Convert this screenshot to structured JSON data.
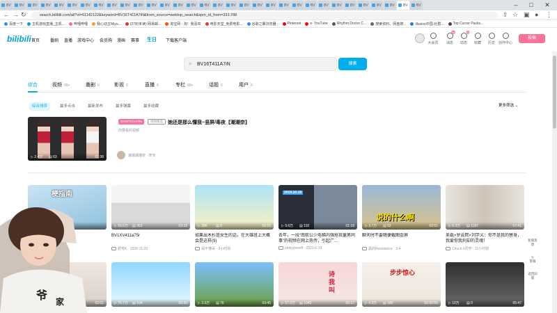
{
  "browser": {
    "tabs": [
      "BV",
      "BV",
      "BV",
      "BV",
      "BV",
      "BV",
      "BV",
      "BV",
      "BV",
      "BV",
      "BV",
      "BV",
      "BV",
      "BV",
      "BV",
      "BV",
      "BV",
      "BV",
      "BV",
      "BV",
      "BV",
      "BV",
      "BV",
      "BV",
      "BV",
      "BV",
      "BV",
      "BV",
      "BV",
      "BV",
      "BV",
      "BV"
    ],
    "active_tab": "BV",
    "url": "search.bilibili.com/all?vt=61142122&keyword=BV16T411A7iN&from_source=webtop_search&spm_id_from=333.788",
    "bookmarks": [
      "百度一下",
      "主机游戏直播_主机...",
      "哔哩哔哩",
      "我心动主Miyu...",
      "(27封未读) 网易邮...",
      "淘宝网 - 淘！我喜欢",
      "电影天堂_免费电影...",
      "谷歌之翼浏览器 -",
      "Pinterest",
      "e- YouTube",
      "Rhythm Doctor C...",
      "搜索资料、网盘搜...",
      "illusion中国-社群...",
      "Top Cursor Packs..."
    ],
    "bookmark_colors": [
      "#3388ff",
      "#00a1d6",
      "#fb7299",
      "#ff9a3c",
      "#d43c33",
      "#ff5000",
      "#d43c33",
      "#4285f4",
      "#e60023",
      "#ff0000",
      "#555555",
      "#666666",
      "#2b7cd3",
      "#444444"
    ]
  },
  "header": {
    "logo": "bilibili",
    "nav": [
      "首页",
      "番剧",
      "直播",
      "游戏中心",
      "会员购",
      "漫画",
      "赛事",
      "生日",
      "下载客户端"
    ],
    "user_menu": [
      "大会员",
      "消息",
      "动态",
      "收藏",
      "历史",
      "创作中心"
    ],
    "message_badge": "99",
    "dynamic_badge": "3",
    "upload": "投稿"
  },
  "search": {
    "query": "BV16T411A7iN",
    "button": "搜索"
  },
  "type_tabs": [
    {
      "label": "综合",
      "count": ""
    },
    {
      "label": "视频",
      "count": "99+"
    },
    {
      "label": "番剧",
      "count": "0"
    },
    {
      "label": "影视",
      "count": "0"
    },
    {
      "label": "直播",
      "count": "0"
    },
    {
      "label": "专栏",
      "count": "99+"
    },
    {
      "label": "话题",
      "count": "0"
    },
    {
      "label": "用户",
      "count": "0"
    }
  ],
  "sort": [
    "综合排序",
    "最多点击",
    "最新发布",
    "最多弹幕",
    "最多收藏"
  ],
  "more_filter": "更多筛选",
  "top_result": {
    "tag": "BV16T411A7iN",
    "tag2": "视频精选",
    "title": "她还是那么懂我~竖屏/毒夜【潮潮奈】",
    "subtitle": "你要看的视频",
    "plays": "2.4万",
    "danmaku": "63",
    "duration": "01:38",
    "uploader": "潮潮潮潮奈 · 昨天"
  },
  "videos": [
    {
      "title": "",
      "plays": "",
      "danmaku": "",
      "duration": "",
      "uploader": "",
      "date": "",
      "thumb_text": "梗指南"
    },
    {
      "title": "BV1XV411a75r",
      "plays": "93.6万",
      "danmaku": "363",
      "duration": "03:18",
      "uploader": "肥宅K",
      "date": "2020-11-29",
      "thumb_text": ""
    },
    {
      "title": "如果出木杉是女生的话，在大雄班上大概会是这样(9)",
      "plays": "386",
      "danmaku": "0",
      "duration": "02:55",
      "uploader": "闹不懂哥",
      "date": "3小时前",
      "thumb_text": ""
    },
    {
      "title": "去年，一段“南航公少电梯内强抢孩童男同事”的视频在网上热传，引起广...",
      "plays": "9.6万",
      "danmaku": "192",
      "duration": "01:18",
      "uploader": "pinkyplssoff",
      "date": "2020-6-19",
      "thumb_text": "2019.10.18"
    },
    {
      "title": "聊天时不要随便截图金屏",
      "plays": "3.7万",
      "danmaku": "52",
      "duration": "02:51",
      "uploader": "黑的Resistance",
      "date": "3-4",
      "thumb_text": "说的什么啊"
    },
    {
      "title": "吴磊×罗云熙×刘学义：你不是我的替身，我爱你我刹却的灵魂！",
      "plays": "6.3万",
      "danmaku": "1187",
      "duration": "07:41",
      "uploader": "Chuck·b同学",
      "date": "11小时前",
      "thumb_text": ""
    },
    {
      "title": "",
      "plays": "",
      "danmaku": "",
      "duration": "02:01",
      "uploader": "",
      "date": "",
      "thumb_text": ""
    },
    {
      "title": "",
      "plays": "75.7万",
      "danmaku": "104",
      "duration": "00:30",
      "uploader": "",
      "date": "",
      "thumb_text": ""
    },
    {
      "title": "",
      "plays": "3.3万",
      "danmaku": "76",
      "duration": "03:45",
      "uploader": "",
      "date": "",
      "thumb_text": ""
    },
    {
      "title": "",
      "plays": "57.3万",
      "danmaku": "1043",
      "duration": "02:17",
      "uploader": "",
      "date": "",
      "thumb_text": "诗 我 叫"
    },
    {
      "title": "",
      "plays": "4.3万",
      "danmaku": "180",
      "duration": "02:00:55",
      "uploader": "",
      "date": "",
      "thumb_text": "步步惊心"
    },
    {
      "title": "",
      "plays": "10万",
      "danmaku": "0",
      "duration": "05:47",
      "uploader": "",
      "date": "",
      "thumb_text": ""
    }
  ],
  "float_bar": [
    "新版反馈",
    "客服",
    "返回旧版"
  ],
  "colors": {
    "accent": "#00aeec",
    "pink": "#fb7299"
  }
}
